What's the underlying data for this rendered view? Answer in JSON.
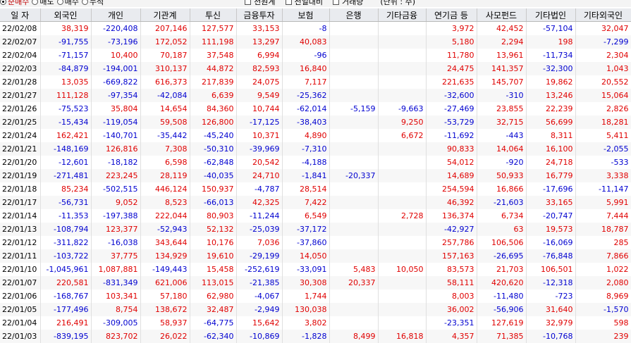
{
  "options": {
    "radios": [
      "순매수",
      "매도",
      "매수",
      "누적"
    ],
    "checks": [
      "천원계",
      "전일대비",
      "거래량"
    ],
    "unit": "(단위 : 주)"
  },
  "columns": [
    "일 자",
    "외국인",
    "개인",
    "기관계",
    "투신",
    "금융투자",
    "보험",
    "은행",
    "기타금융",
    "연기금 등",
    "사모펀드",
    "기타법인",
    "기타외국인"
  ],
  "rows": [
    [
      "22/02/08",
      "38,319",
      "-220,408",
      "207,146",
      "127,577",
      "33,153",
      "-8",
      "",
      "",
      "3,972",
      "42,452",
      "-57,104",
      "32,047"
    ],
    [
      "22/02/07",
      "-91,755",
      "-73,196",
      "172,052",
      "111,198",
      "13,297",
      "40,083",
      "",
      "",
      "5,180",
      "2,294",
      "198",
      "-7,299"
    ],
    [
      "22/02/04",
      "-71,157",
      "10,400",
      "70,187",
      "37,548",
      "6,994",
      "-96",
      "",
      "",
      "11,780",
      "13,961",
      "-11,734",
      "2,304"
    ],
    [
      "22/02/03",
      "-84,879",
      "-194,001",
      "310,137",
      "44,872",
      "82,593",
      "16,840",
      "",
      "",
      "24,475",
      "141,357",
      "-32,300",
      "1,043"
    ],
    [
      "22/01/28",
      "13,035",
      "-669,822",
      "616,373",
      "217,839",
      "24,075",
      "7,117",
      "",
      "",
      "221,635",
      "145,707",
      "19,862",
      "20,552"
    ],
    [
      "22/01/27",
      "111,128",
      "-97,354",
      "-42,084",
      "6,639",
      "9,549",
      "-25,362",
      "",
      "",
      "-32,600",
      "-310",
      "13,246",
      "15,064"
    ],
    [
      "22/01/26",
      "-75,523",
      "35,804",
      "14,654",
      "84,360",
      "10,744",
      "-62,014",
      "-5,159",
      "-9,663",
      "-27,469",
      "23,855",
      "22,239",
      "2,826"
    ],
    [
      "22/01/25",
      "-15,434",
      "-119,054",
      "59,508",
      "126,800",
      "-17,125",
      "-38,403",
      "",
      "9,250",
      "-53,729",
      "32,715",
      "56,699",
      "18,281"
    ],
    [
      "22/01/24",
      "162,421",
      "-140,701",
      "-35,442",
      "-45,240",
      "10,371",
      "4,890",
      "",
      "6,672",
      "-11,692",
      "-443",
      "8,311",
      "5,411"
    ],
    [
      "22/01/21",
      "-148,169",
      "126,816",
      "7,308",
      "-50,310",
      "-39,969",
      "-7,310",
      "",
      "",
      "90,833",
      "14,064",
      "16,100",
      "-2,055"
    ],
    [
      "22/01/20",
      "-12,601",
      "-18,182",
      "6,598",
      "-62,848",
      "20,542",
      "-4,188",
      "",
      "",
      "54,012",
      "-920",
      "24,718",
      "-533"
    ],
    [
      "22/01/19",
      "-271,481",
      "223,245",
      "28,119",
      "-40,035",
      "24,710",
      "-1,841",
      "-20,337",
      "",
      "14,689",
      "50,933",
      "16,779",
      "3,338"
    ],
    [
      "22/01/18",
      "85,234",
      "-502,515",
      "446,124",
      "150,937",
      "-4,787",
      "28,514",
      "",
      "",
      "254,594",
      "16,866",
      "-17,696",
      "-11,147"
    ],
    [
      "22/01/17",
      "-56,731",
      "9,052",
      "8,523",
      "-66,013",
      "42,325",
      "7,422",
      "",
      "",
      "46,392",
      "-21,603",
      "33,165",
      "5,991"
    ],
    [
      "22/01/14",
      "-11,353",
      "-197,388",
      "222,044",
      "80,903",
      "-11,244",
      "6,549",
      "",
      "2,728",
      "136,374",
      "6,734",
      "-20,747",
      "7,444"
    ],
    [
      "22/01/13",
      "-108,794",
      "123,377",
      "-52,943",
      "52,132",
      "-25,039",
      "-37,172",
      "",
      "",
      "-42,927",
      "63",
      "19,573",
      "18,787"
    ],
    [
      "22/01/12",
      "-311,822",
      "-16,038",
      "343,644",
      "10,176",
      "7,036",
      "-37,860",
      "",
      "",
      "257,786",
      "106,506",
      "-16,069",
      "285"
    ],
    [
      "22/01/11",
      "-103,722",
      "37,775",
      "134,929",
      "19,610",
      "-29,199",
      "14,050",
      "",
      "",
      "157,163",
      "-26,695",
      "-76,848",
      "7,866"
    ],
    [
      "22/01/10",
      "-1,045,961",
      "1,087,881",
      "-149,443",
      "15,458",
      "-252,619",
      "-33,091",
      "5,483",
      "10,050",
      "83,573",
      "21,703",
      "106,501",
      "1,022"
    ],
    [
      "22/01/07",
      "220,581",
      "-831,349",
      "621,006",
      "113,015",
      "-21,385",
      "30,308",
      "20,337",
      "",
      "58,111",
      "420,620",
      "-12,318",
      "2,080"
    ],
    [
      "22/01/06",
      "-168,767",
      "103,341",
      "57,180",
      "62,980",
      "-4,067",
      "1,744",
      "",
      "",
      "8,003",
      "-11,480",
      "-723",
      "8,969"
    ],
    [
      "22/01/05",
      "-177,496",
      "8,754",
      "138,672",
      "32,487",
      "-2,949",
      "130,038",
      "",
      "",
      "36,002",
      "-56,906",
      "31,640",
      "-1,570"
    ],
    [
      "22/01/04",
      "216,491",
      "-309,005",
      "58,937",
      "-64,775",
      "15,642",
      "3,802",
      "",
      "",
      "-23,351",
      "127,619",
      "32,979",
      "598"
    ],
    [
      "22/01/03",
      "-839,195",
      "823,702",
      "26,022",
      "-62,340",
      "-10,869",
      "-1,828",
      "8,499",
      "16,818",
      "4,357",
      "71,385",
      "-10,768",
      "239"
    ]
  ]
}
